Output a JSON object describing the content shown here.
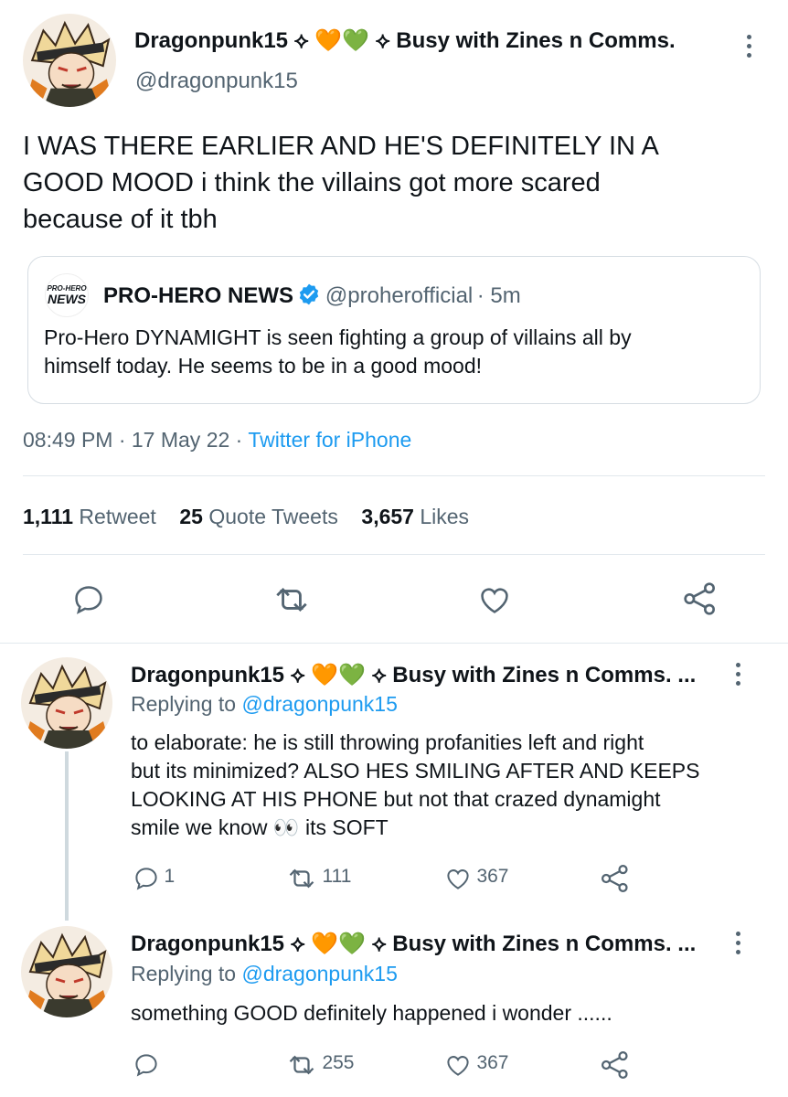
{
  "main_tweet": {
    "display_name": "Dragonpunk15",
    "emoji_1": "⟡",
    "emoji_hearts": "🧡💚",
    "emoji_2": "⟡",
    "status_text": "Busy with Zines n Comms.",
    "handle": "@dragonpunk15",
    "text_line1": "I WAS THERE EARLIER AND HE'S DEFINITELY IN A",
    "text_line2": "GOOD MOOD i think the villains got more scared",
    "text_line3": "because of it tbh",
    "timestamp": "08:49 PM · 17 May 22 ·",
    "source": "Twitter for iPhone",
    "stats": {
      "retweets": "1,111",
      "retweets_label": "Retweet",
      "quotes": "25",
      "quotes_label": "Quote Tweets",
      "likes": "3,657",
      "likes_label": "Likes"
    }
  },
  "quoted_tweet": {
    "avatar_logo_line1": "PRO-HERO",
    "avatar_logo_line2": "NEWS",
    "name": "PRO-HERO NEWS",
    "handle": "@proherofficial",
    "time": "· 5m",
    "text_line1": "Pro-Hero DYNAMIGHT is seen fighting a group of villains all by",
    "text_line2": "himself today. He seems to be in a good mood!"
  },
  "replies": [
    {
      "display_name": "Dragonpunk15",
      "emoji_1": "⟡",
      "emoji_hearts": "🧡💚",
      "emoji_2": "⟡",
      "status_text": "Busy with Zines n Comms. ...",
      "replying_to_label": "Replying to",
      "replying_to_handle": "@dragonpunk15",
      "text_line1": "to elaborate: he is still throwing profanities left and right",
      "text_line2": "but its minimized? ALSO HES SMILING AFTER AND KEEPS",
      "text_line3": "LOOKING AT HIS PHONE but not that crazed dynamight",
      "text_line4": "smile we know 👀 its SOFT",
      "reply_count": "1",
      "retweet_count": "111",
      "like_count": "367"
    },
    {
      "display_name": "Dragonpunk15",
      "emoji_1": "⟡",
      "emoji_hearts": "🧡💚",
      "emoji_2": "⟡",
      "status_text": "Busy with Zines n Comms. ...",
      "replying_to_label": "Replying to",
      "replying_to_handle": "@dragonpunk15",
      "text_line1": "something GOOD definitely happened i wonder ......",
      "reply_count": "",
      "retweet_count": "255",
      "like_count": "367"
    }
  ],
  "colors": {
    "link": "#1d9bf0",
    "muted": "#536471",
    "verified": "#1d9bf0",
    "divider": "#e1e8ed"
  },
  "icons": [
    "reply-icon",
    "retweet-icon",
    "like-icon",
    "share-icon",
    "more-icon",
    "verified-badge-icon"
  ]
}
